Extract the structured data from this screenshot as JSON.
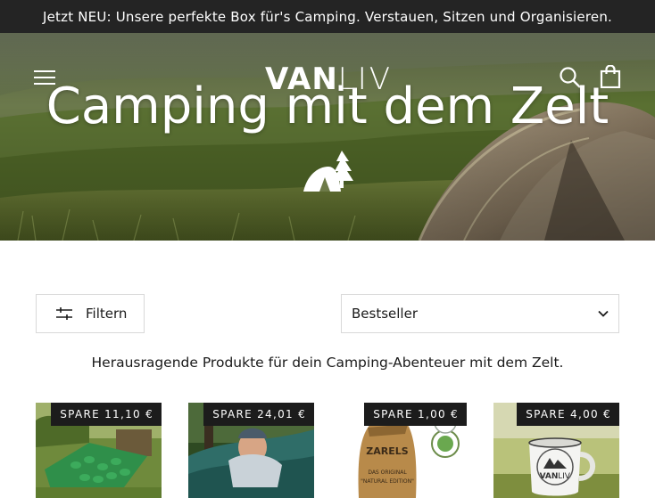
{
  "announcement": "Jetzt NEU: Unsere perfekte Box für's Camping. Verstauen, Sitzen und Organisieren.",
  "header": {
    "logo_bold": "VAN",
    "logo_light": "LIV",
    "menu_icon": "hamburger-menu-icon",
    "search_icon": "search-icon",
    "cart_icon": "shopping-bag-icon"
  },
  "hero": {
    "title": "Camping mit dem Zelt",
    "icon": "tent-with-tree-icon"
  },
  "toolbar": {
    "filter_label": "Filtern",
    "sort_selected": "Bestseller"
  },
  "collection_intro": "Herausragende Produkte für dein Camping-Abenteuer mit dem Zelt.",
  "products": [
    {
      "badge": "SPARE 11,10 €",
      "image": "green inflatable sleeping mat in grass"
    },
    {
      "badge": "SPARE 24,01 €",
      "image": "man resting in hammock"
    },
    {
      "badge": "SPARE 1,00 €",
      "image": "burlap bag of firelighters"
    },
    {
      "badge": "SPARE 4,00 €",
      "image": "white enamel mug with logo"
    }
  ],
  "product_bag_text": [
    "ZARELS",
    "DAS ORIGINAL",
    "\"NATURAL EDITION\""
  ],
  "mug_logo": [
    "VAN",
    "LIV"
  ],
  "colors": {
    "announcement_bg": "#242424",
    "badge_bg": "#1c1c1c",
    "border": "#d9d9d9"
  }
}
